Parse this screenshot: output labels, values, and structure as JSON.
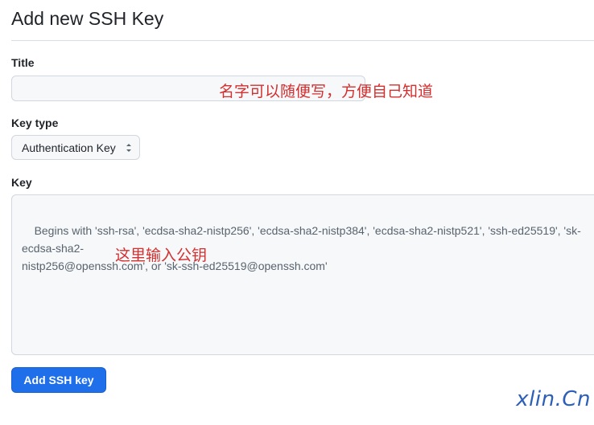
{
  "page": {
    "title": "Add new SSH Key"
  },
  "form": {
    "title_label": "Title",
    "title_value": "",
    "key_type_label": "Key type",
    "key_type_selected": "Authentication Key",
    "key_label": "Key",
    "key_placeholder": "Begins with 'ssh-rsa', 'ecdsa-sha2-nistp256', 'ecdsa-sha2-nistp384', 'ecdsa-sha2-nistp521', 'ssh-ed25519', 'sk-ecdsa-sha2-\nnistp256@openssh.com', or 'sk-ssh-ed25519@openssh.com'",
    "submit_label": "Add SSH key"
  },
  "annotations": {
    "title_note": "名字可以随便写，方便自己知道",
    "key_note": "这里输入公钥"
  },
  "watermark": "xlin.Cn",
  "colors": {
    "primary_button": "#1f6feb",
    "annotation": "#d32f2f",
    "watermark": "#2c5fb8",
    "border": "#d0d7de",
    "field_bg": "#f6f8fa"
  },
  "icons": {
    "select_caret": "select-caret-icon"
  }
}
